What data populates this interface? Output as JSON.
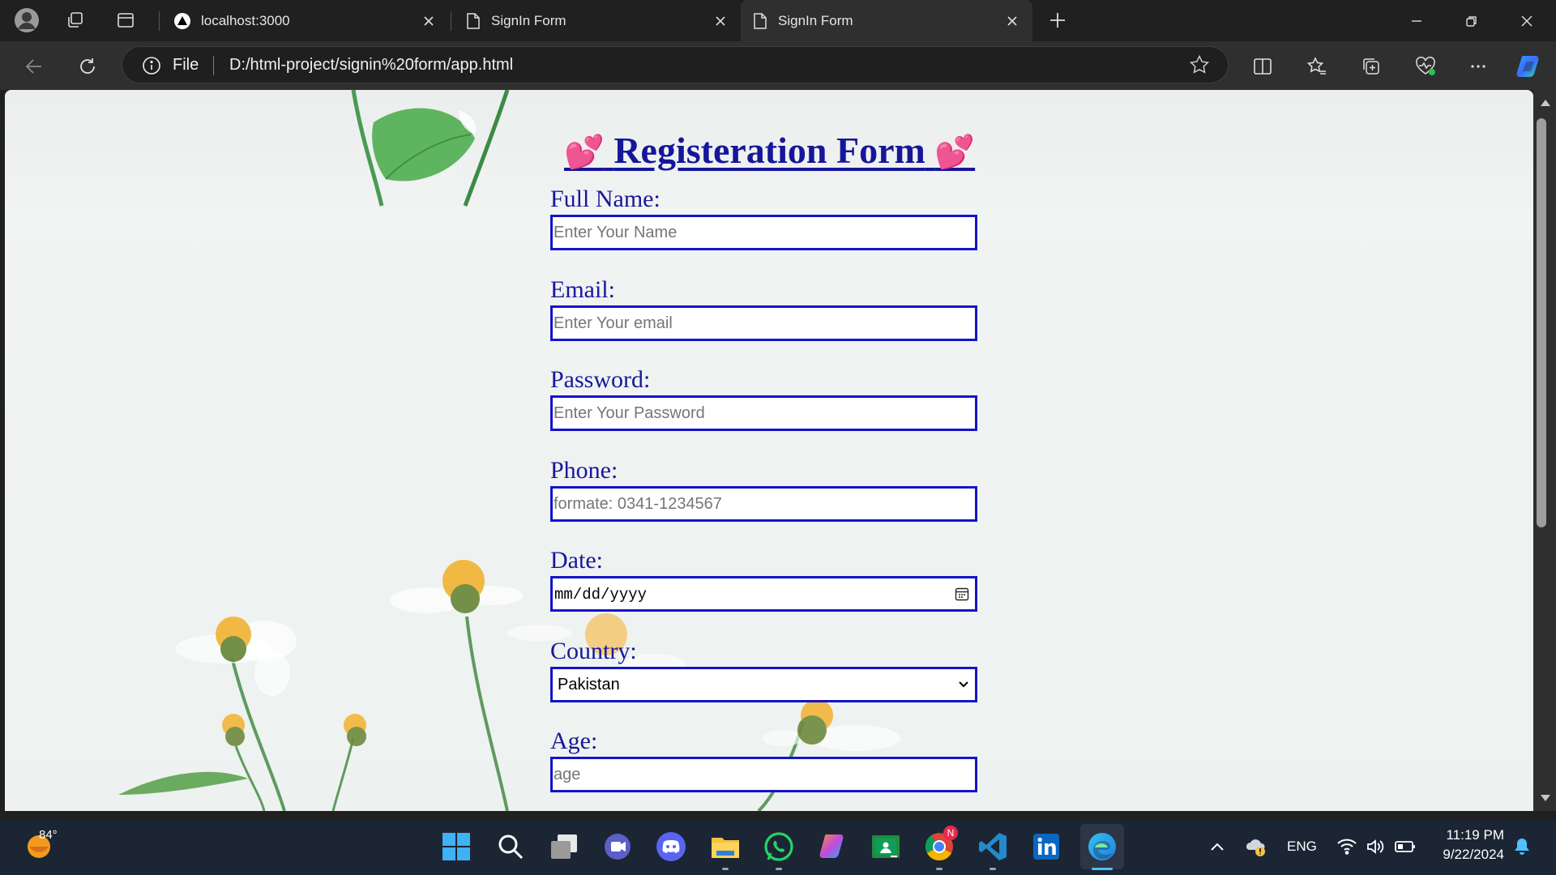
{
  "browser": {
    "tabs": [
      {
        "label": "localhost:3000",
        "active": false
      },
      {
        "label": "SignIn Form",
        "active": false
      },
      {
        "label": "SignIn Form",
        "active": true
      }
    ],
    "address": {
      "scheme_label": "File",
      "url": "D:/html-project/signin%20form/app.html"
    }
  },
  "form": {
    "title": "Registeration Form",
    "title_hearts": "💕",
    "fields": [
      {
        "label": "Full Name:",
        "placeholder": "Enter Your Name"
      },
      {
        "label": "Email:",
        "placeholder": "Enter Your email"
      },
      {
        "label": "Password:",
        "placeholder": "Enter Your Password"
      },
      {
        "label": "Phone:",
        "placeholder": "formate: 0341-1234567"
      },
      {
        "label": "Date:",
        "value": "mm/dd/yyyy"
      },
      {
        "label": "Country:",
        "value": "Pakistan"
      },
      {
        "label": "Age:",
        "placeholder": "age"
      }
    ]
  },
  "taskbar": {
    "weather_temp": "84°",
    "apps": [
      "start",
      "search",
      "task-view",
      "teams",
      "discord",
      "file-explorer",
      "whatsapp",
      "copilot",
      "classroom",
      "chrome",
      "vscode",
      "linkedin",
      "edge"
    ],
    "chrome_badge": "N",
    "language": "ENG",
    "time": "11:19 PM",
    "date": "9/22/2024"
  },
  "colors": {
    "accent_blue": "#16169a",
    "input_border": "#1414c8",
    "heart": "#e8284c",
    "taskbar": "#1c2533"
  }
}
